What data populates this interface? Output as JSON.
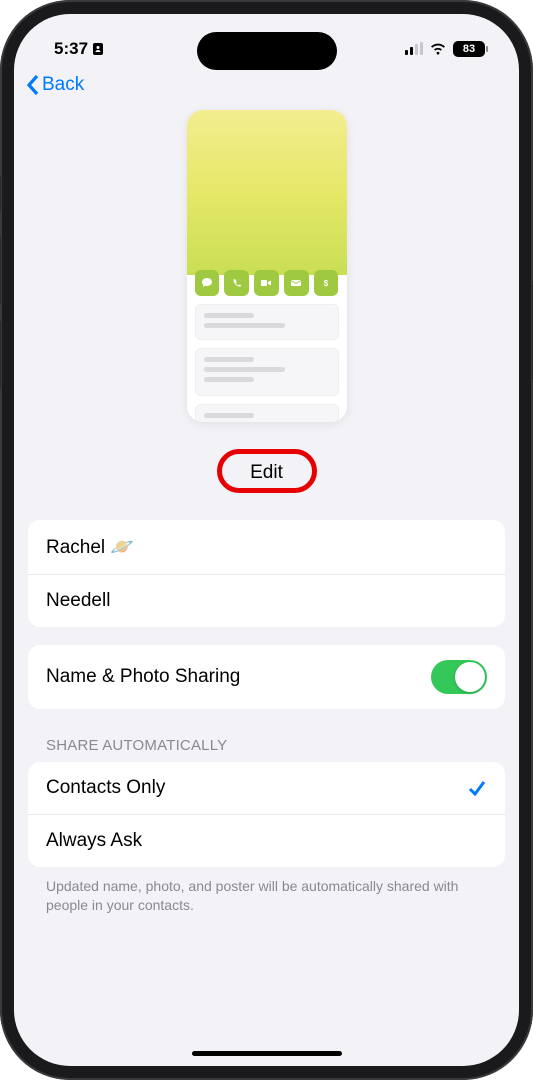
{
  "status": {
    "time": "5:37",
    "battery": "83"
  },
  "nav": {
    "back": "Back"
  },
  "edit": {
    "label": "Edit"
  },
  "name": {
    "first": "Rachel 🪐",
    "last": "Needell"
  },
  "sharing": {
    "label": "Name & Photo Sharing",
    "enabled": true
  },
  "shareAuto": {
    "header": "SHARE AUTOMATICALLY",
    "options": [
      {
        "label": "Contacts Only",
        "selected": true
      },
      {
        "label": "Always Ask",
        "selected": false
      }
    ],
    "footer": "Updated name, photo, and poster will be automatically shared with people in your contacts."
  }
}
